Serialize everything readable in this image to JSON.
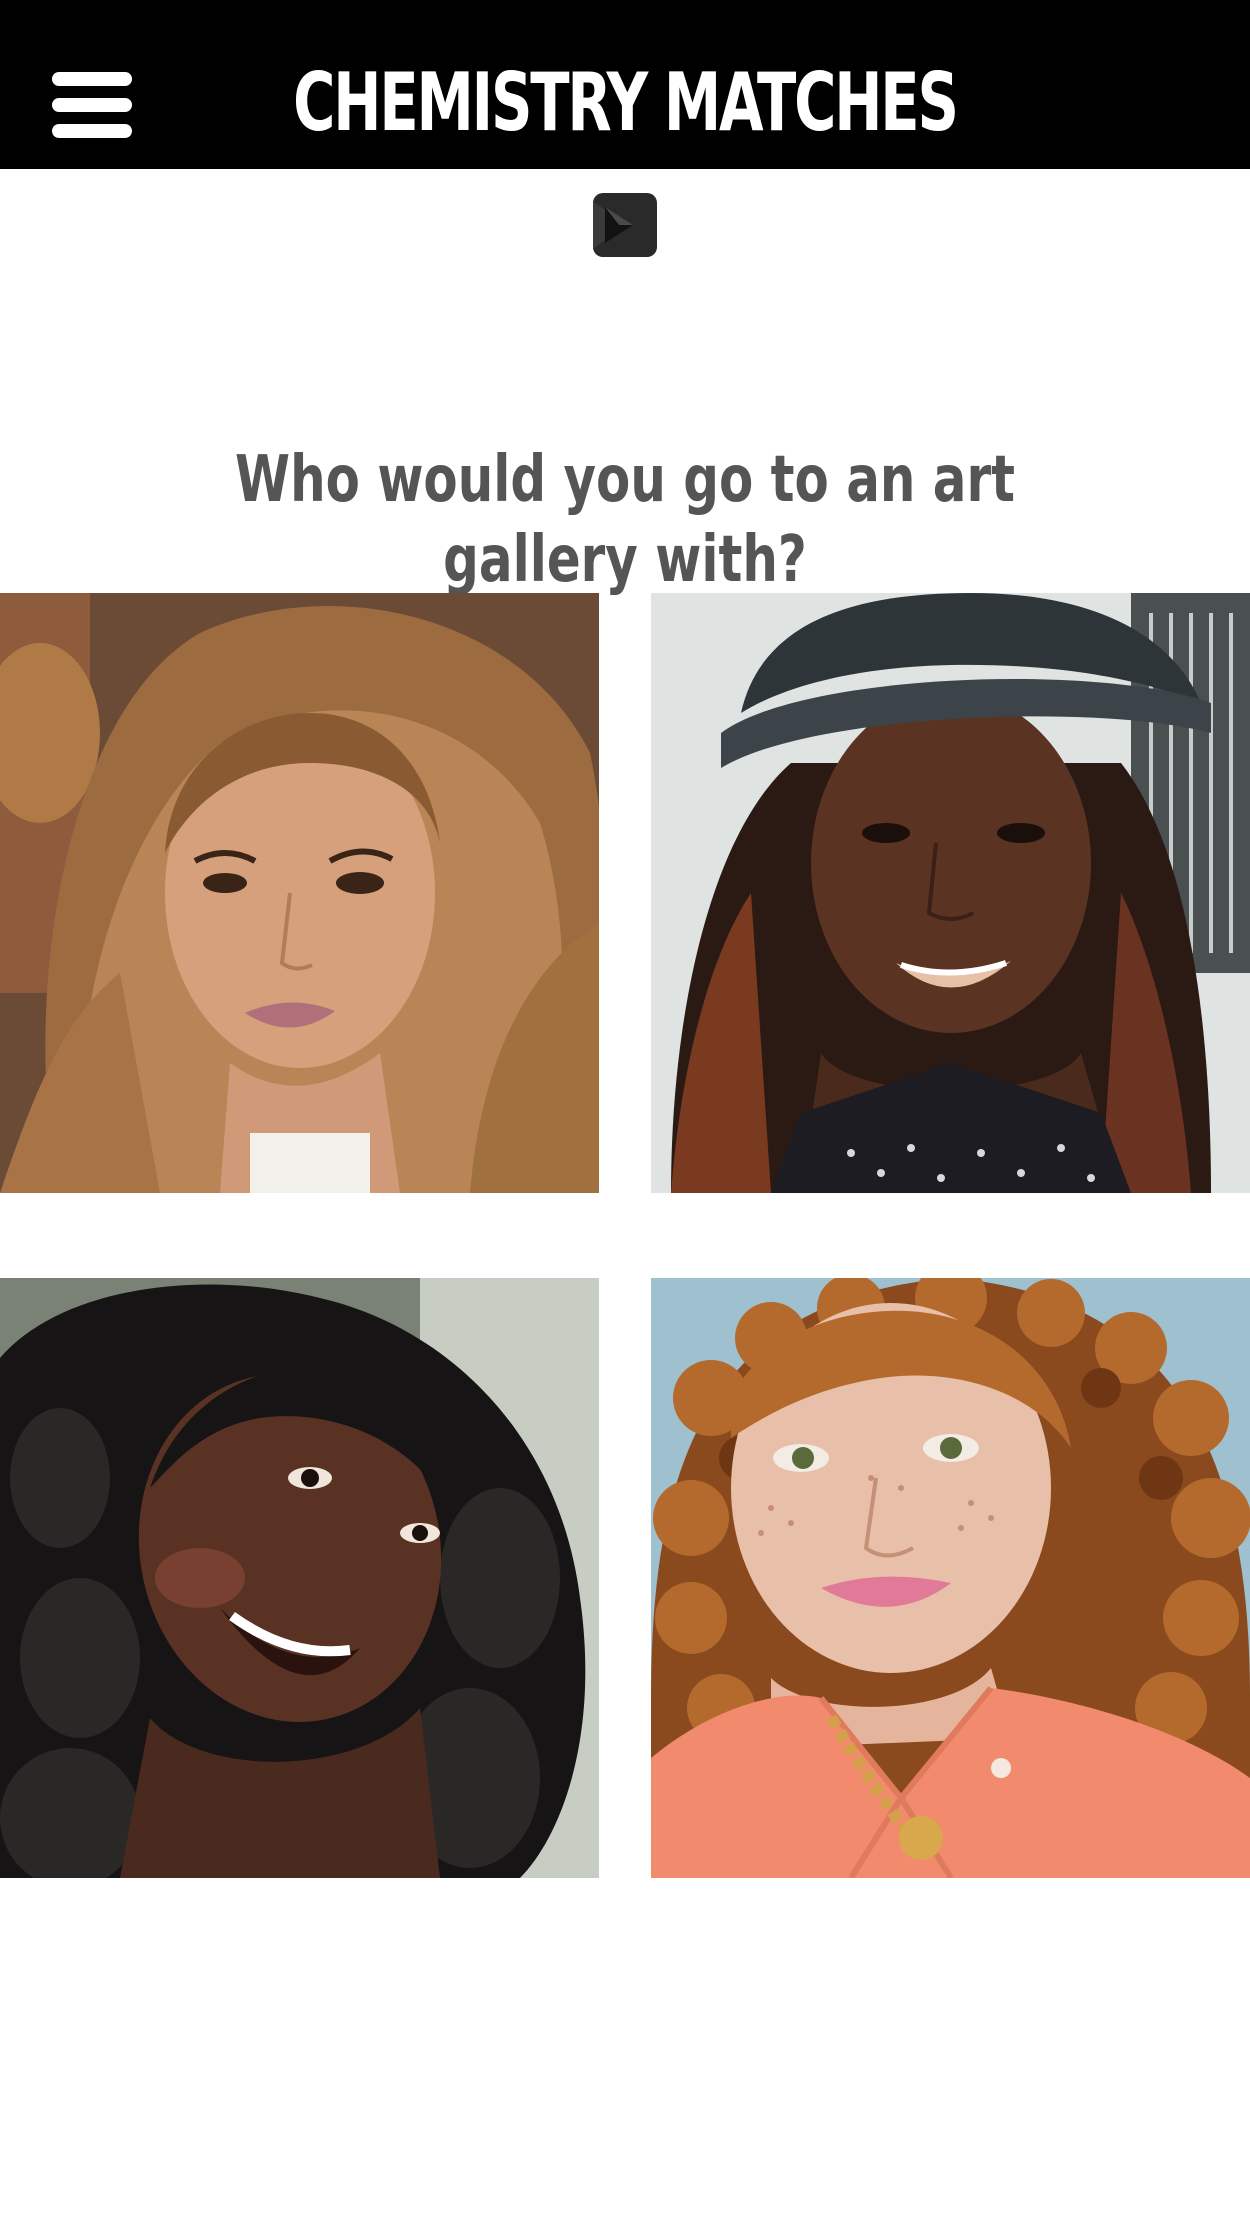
{
  "header": {
    "title": "CHEMISTRY MATCHES",
    "menu_icon": "hamburger-menu-icon"
  },
  "navigation": {
    "next_icon": "chevron-right-icon"
  },
  "question": {
    "text": "Who would you go to an art gallery with?"
  },
  "photos": [
    {
      "id": "photo-1",
      "description": "selfie portrait, long light brown wavy hair"
    },
    {
      "id": "photo-2",
      "description": "selfie portrait, black leather cap, long hair"
    },
    {
      "id": "photo-3",
      "description": "selfie portrait, long black curly hair, smiling"
    },
    {
      "id": "photo-4",
      "description": "selfie portrait, red curly hair, coral shirt"
    }
  ],
  "colors": {
    "header_bg": "#000000",
    "header_text": "#ffffff",
    "question_text": "#555555",
    "page_bg": "#ffffff"
  }
}
